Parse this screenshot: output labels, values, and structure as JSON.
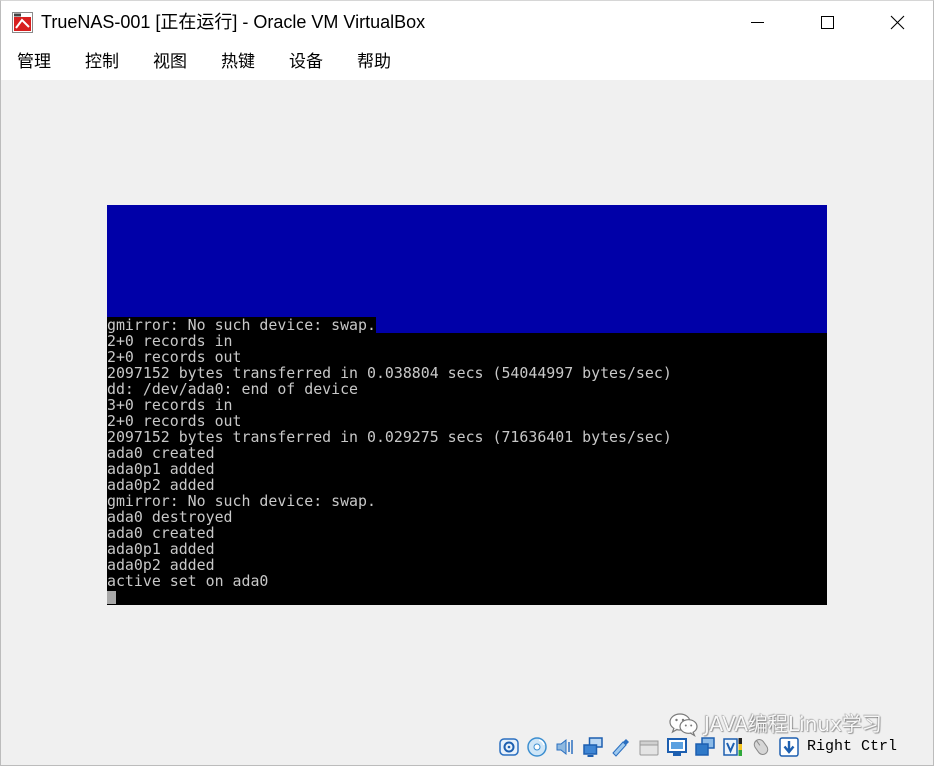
{
  "window": {
    "title": "TrueNAS-001 [正在运行] - Oracle VM VirtualBox",
    "app_icon": "vm-os-icon",
    "controls": [
      "minimize-icon",
      "maximize-icon",
      "close-icon"
    ]
  },
  "menu": {
    "items": [
      "管理",
      "控制",
      "视图",
      "热键",
      "设备",
      "帮助"
    ]
  },
  "vm_screen": {
    "colors": {
      "header": "#0000a8",
      "background": "#000000",
      "text": "#c8c8c8",
      "cursor": "#a8a8a8"
    },
    "lines": [
      "gmirror: No such device: swap.",
      "2+0 records in",
      "2+0 records out",
      "2097152 bytes transferred in 0.038804 secs (54044997 bytes/sec)",
      "dd: /dev/ada0: end of device",
      "3+0 records in",
      "2+0 records out",
      "2097152 bytes transferred in 0.029275 secs (71636401 bytes/sec)",
      "ada0 created",
      "ada0p1 added",
      "ada0p2 added",
      "gmirror: No such device: swap.",
      "ada0 destroyed",
      "ada0 created",
      "ada0p1 added",
      "ada0p2 added",
      "active set on ada0"
    ]
  },
  "status_bar": {
    "indicators": [
      "hard-disk-icon",
      "optical-disc-icon",
      "audio-icon",
      "network-icon",
      "usb-icon",
      "shared-folder-icon",
      "display-icon",
      "recording-icon",
      "vtx-feature-icon",
      "mouse-integration-icon",
      "keyboard-capture-icon"
    ],
    "host_key": "Right Ctrl"
  },
  "watermark": {
    "text": "JAVA编程Linux学习",
    "icon": "wechat-icon"
  }
}
